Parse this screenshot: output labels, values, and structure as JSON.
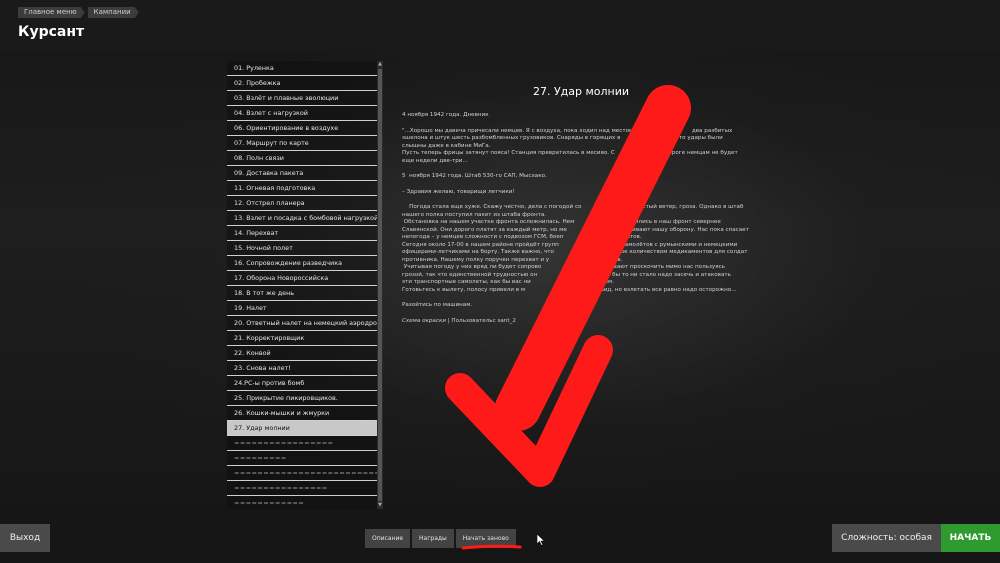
{
  "breadcrumb": [
    "Главное меню",
    "Кампании"
  ],
  "page_title": "Курсант",
  "missions": [
    "01. Руленка",
    "02. Пробежка",
    "03. Взлёт и плавные эволюции",
    "04. Взлет с нагрузкой",
    "06. Ориентирование в воздухе",
    "07. Маршрут по карте",
    "08. Полн связи",
    "09. Доставка пакета",
    "11. Огневая подготовка",
    "12. Отстрел планера",
    "13. Взлет и посадка с бомбовой нагрузкой",
    "14. Перехват",
    "15. Ночной полет",
    "16. Сопровождение разведчика",
    "17. Оборона Новороссийска",
    "18. В тот же день",
    "19. Налет",
    "20. Ответный налет на немецкий аэродром",
    "21. Корректировщик",
    "22. Конвой",
    "23. Снова налет!",
    "24.РС-ы против бомб",
    "25. Прикрытие пикировщиков.",
    "26. Кошки-мышки и жмурки",
    "27. Удар молнии",
    "=================",
    "=========",
    "===========================",
    "================",
    "============",
    "=========="
  ],
  "selected_index": 24,
  "mission": {
    "title": "27. Удар молнии",
    "paragraphs": [
      "4 ноября 1942 года. Дневник",
      "\"...Хорошо мы давеча причесали немцев. Я с воздуха, пока ходил над местом                                 два разбитых\nэшелона и штук шесть разбомбленных грузовиков. Снаряды в горящих в                             , что удары были\nслышны даже в кабине МиГа.\nПусть теперь фрицы затянут пояса! Станция превратилась в месиво. С                            дороге немцам не будет\nеще недели две-три...",
      "5  ноября 1942 года. Штаб 530-го САП, Мысхако.",
      "– Здравия желаю, товарищи летчики!",
      "    Погода стала еще хуже. Скажу честно, дела с погодой со                      порывистый ветер, гроза. Однако в штаб\nнашего полка поступил пакет из штаба фронта.\n Обстановка на нашем участке фронта осложнилась. Нем                              лнились в наш фронт севернее\nСлавянской. Они дорого платят за каждый метр, но ме                               авливают нашу оборону. Нас пока спасает\nнепогода – у немцев сложности с подвозом ГСМ, боеп                     едикаментов.\nСегодня около 17-00 в нашем районе пройдёт групп                            ных самолётов с румынскими и немецкими\nофицерами-летчиками на борту. Также важно, что                           большое количеством медикаментов для солдат\nпротивника. Нашему полку поручен перехват и у               тих  самолётов.\n Учитывая погоду у них вряд ли будет сопрово                         рассчитывают проскочить мимо нас пользуясь\nгрозой, так что единственной трудностью он                          а. Вам во бы то ни стало надо засечь и атаковать\nэти транспортные самолеты, как бы вас ни                          м и дождем.\nГотовьтесь к вылету, полосу привели в м                           ожеский вид, но взлетать все равно надо осторожно...",
      "Разойтись по машинам."
    ],
    "skin_label": "Схема окраски",
    "skin_value": " | Пользовательс                                  sant_2"
  },
  "tabs": [
    "Описание",
    "Награды",
    "Начать заново"
  ],
  "buttons": {
    "exit": "Выход",
    "difficulty": "Сложность: особая",
    "start": "НАЧАТЬ"
  },
  "colors": {
    "start_button": "#2f9a2f",
    "annotation": "#ff1a1a"
  },
  "icons": [
    "cursor-icon",
    "red-arrow-annotation"
  ]
}
